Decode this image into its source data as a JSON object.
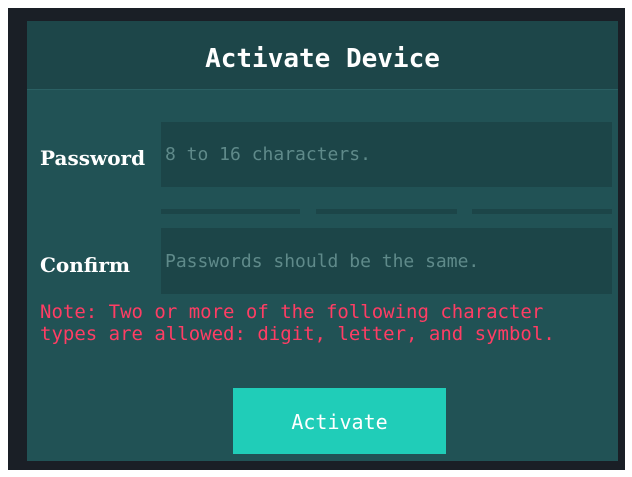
{
  "dialog": {
    "title": "Activate Device",
    "password": {
      "label": "Password",
      "value": "",
      "placeholder": "8 to 16 characters."
    },
    "password_strength": {
      "segments": 3,
      "filled": 0
    },
    "confirm": {
      "label": "Confirm",
      "value": "",
      "placeholder": "Passwords should be the same."
    },
    "note": "Note: Two or more of the following character types are allowed: digit, letter, and symbol.",
    "activate_label": "Activate"
  },
  "colors": {
    "background": "#215255",
    "header": "#1d4649",
    "input": "#1c4548",
    "note": "#ff3d64",
    "accent": "#20cdb8"
  }
}
